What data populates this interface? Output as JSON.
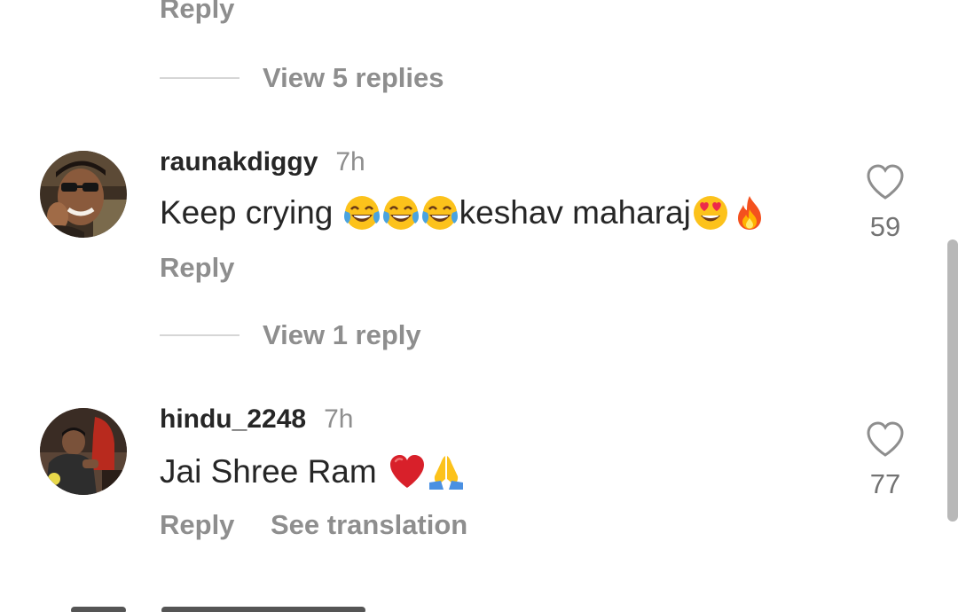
{
  "thread": {
    "top_reply_label": "Reply",
    "top_view_replies": "View 5 replies"
  },
  "comments": [
    {
      "username": "raunakdiggy",
      "time": "7h",
      "text_parts": [
        "Keep crying ",
        "keshav maharaj"
      ],
      "emojis": [
        "face-with-tears-of-joy-emoji",
        "face-with-tears-of-joy-emoji",
        "face-with-tears-of-joy-emoji",
        "smiling-face-with-heart-eyes-emoji",
        "fire-emoji"
      ],
      "likes": "59",
      "reply_label": "Reply",
      "view_replies": "View 1 reply"
    },
    {
      "username": "hindu_2248",
      "time": "7h",
      "text": "Jai Shree Ram",
      "emojis": [
        "red-heart-emoji",
        "folded-hands-emoji"
      ],
      "likes": "77",
      "reply_label": "Reply",
      "translation_label": "See translation"
    }
  ],
  "icons": {
    "like": "heart-outline-icon"
  },
  "colors": {
    "text_primary": "#262626",
    "text_secondary": "#8e8e8e",
    "divider": "#d6d6d6",
    "background": "#ffffff"
  }
}
